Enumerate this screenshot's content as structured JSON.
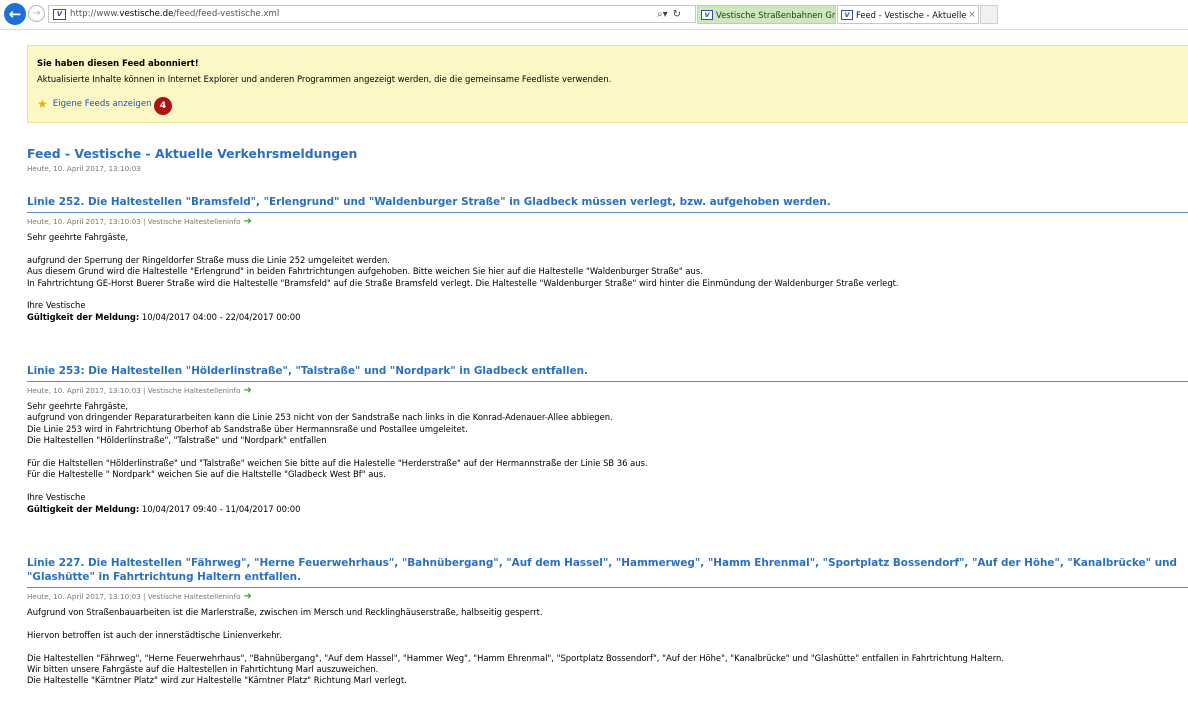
{
  "browser": {
    "url_prefix": "http://www.",
    "url_domain": "vestische.de",
    "url_path": "/feed/feed-vestische.xml",
    "tabs": [
      {
        "label": "Vestische Straßenbahnen Gmb...",
        "active": false
      },
      {
        "label": "Feed - Vestische - Aktuelle ...",
        "active": true,
        "close": "×"
      }
    ],
    "search_icon": "search-dropdown-icon",
    "refresh_icon": "refresh-icon"
  },
  "banner": {
    "title": "Sie haben diesen Feed abonniert!",
    "text": "Aktualisierte Inhalte können in Internet Explorer und anderen Programmen angezeigt werden, die die gemeinsame Feedliste verwenden.",
    "link": "Eigene Feeds anzeigen",
    "step_badge": "4"
  },
  "feed": {
    "title": "Feed - Vestische - Aktuelle Verkehrsmeldungen",
    "date": "Heute, 10. April 2017, 13:10:03"
  },
  "articles": [
    {
      "title": "Linie 252. Die Haltestellen \"Bramsfeld\", \"Erlengrund\" und \"Waldenburger Straße\" in Gladbeck müssen verlegt, bzw. aufgehoben werden.",
      "meta": "Heute, 10. April 2017, 13:10:03 | Vestische Haltestelleninfo",
      "lines": [
        "Sehr geehrte Fahrgäste,",
        "",
        "aufgrund der Sperrung der Ringeldorfer Straße muss die Linie 252 umgeleitet werden.",
        "Aus diesem Grund wird die Haltestelle \"Erlengrund\" in beiden Fahrtrichtungen aufgehoben. Bitte weichen Sie hier auf die Haltestelle \"Waldenburger Straße\" aus.",
        "In Fahrtrichtung GE-Horst Buerer Straße wird die Haltestelle \"Bramsfeld\" auf die Straße Bramsfeld verlegt. Die Haltestelle \"Waldenburger Straße\" wird hinter die Einmündung der Waldenburger Straße verlegt.",
        "",
        "Ihre Vestische"
      ],
      "validity_label": "Gültigkeit der Meldung:",
      "validity_value": " 10/04/2017 04:00 - 22/04/2017 00:00"
    },
    {
      "title": "Linie 253: Die Haltestellen \"Hölderlinstraße\", \"Talstraße\" und \"Nordpark\" in Gladbeck entfallen.",
      "meta": "Heute, 10. April 2017, 13:10:03 | Vestische Haltestelleninfo",
      "lines": [
        "Sehr geehrte Fahrgäste,",
        "aufgrund von dringender Reparaturarbeiten kann die Linie 253 nicht von der Sandstraße nach links in die Konrad-Adenauer-Allee abbiegen.",
        "Die Linie 253 wird in Fahrtrichtung Oberhof ab Sandstraße über Hermannsraße und Postallee umgeleitet.",
        "Die Haltestellen \"Hölderlinstraße\", \"Talstraße\" und \"Nordpark\" entfallen",
        "",
        "Für die Haltstellen \"Hölderlinstraße\" und \"Talstraße\" weichen Sie bitte auf die Halestelle \"Herderstraße\" auf der Hermannstraße der Linie SB 36 aus.",
        "Für die Haltestelle \" Nordpark\" weichen Sie auf die Haltstelle \"Gladbeck West Bf\" aus.",
        "",
        "Ihre Vestische"
      ],
      "validity_label": "Gültigkeit der Meldung:",
      "validity_value": " 10/04/2017 09:40 - 11/04/2017 00:00"
    },
    {
      "title": "Linie 227. Die Haltestellen \"Fährweg\", \"Herne Feuerwehrhaus\", \"Bahnübergang\", \"Auf dem Hassel\", \"Hammerweg\", \"Hamm Ehrenmal\", \"Sportplatz Bossendorf\", \"Auf der Höhe\", \"Kanalbrücke\" und \"Glashütte\" in Fahrtrichtung Haltern entfallen.",
      "meta": "Heute, 10. April 2017, 13:10:03 | Vestische Haltestelleninfo",
      "lines": [
        "Aufgrund von Straßenbauarbeiten ist die Marlerstraße, zwischen im Mersch und Recklinghäuserstraße, halbseitig gesperrt.",
        "",
        "Hiervon betroffen ist auch der innerstädtische Linienverkehr.",
        "",
        "Die Haltestellen \"Fährweg\", \"Herne Feuerwehrhaus\", \"Bahnübergang\", \"Auf dem Hassel\", \"Hammer Weg\", \"Hamm Ehrenmal\", \"Sportplatz Bossendorf\", \"Auf der Höhe\", \"Kanalbrücke\" und \"Glashütte\" entfallen in Fahrtrichtung Haltern.",
        "Wir bitten unsere Fahrgäste auf die Haltestellen in Fahrtichtung Marl auszuweichen.",
        "Die Haltestelle \"Kärntner Platz\" wird zur Haltestelle \"Kärntner Platz\" Richtung Marl verlegt."
      ]
    }
  ]
}
